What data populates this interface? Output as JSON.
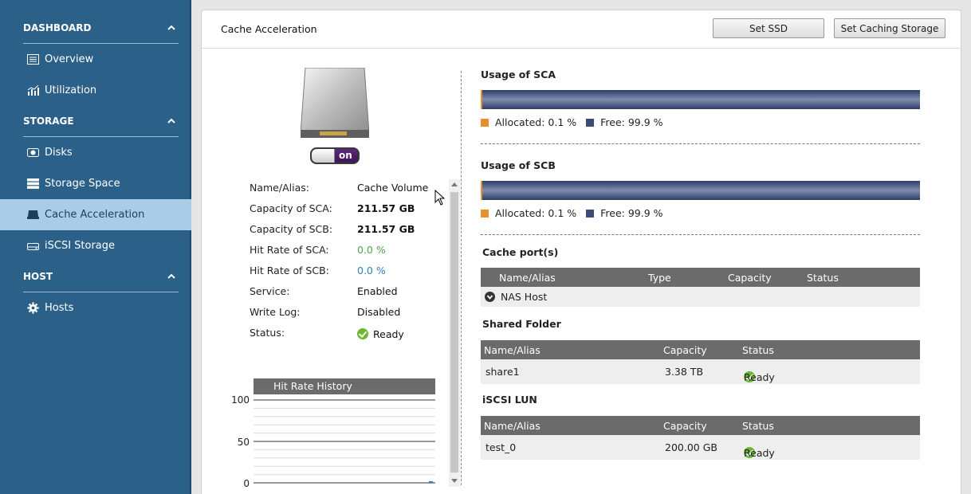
{
  "sidebar": {
    "sections": [
      {
        "label": "DASHBOARD"
      },
      {
        "label": "STORAGE"
      },
      {
        "label": "HOST"
      }
    ],
    "items": [
      {
        "label": "Overview",
        "icon": "overview-icon"
      },
      {
        "label": "Utilization",
        "icon": "utilization-icon"
      },
      {
        "label": "Disks",
        "icon": "disk-icon"
      },
      {
        "label": "Storage Space",
        "icon": "storage-space-icon"
      },
      {
        "label": "Cache Acceleration",
        "icon": "cache-icon"
      },
      {
        "label": "iSCSI Storage",
        "icon": "iscsi-icon"
      },
      {
        "label": "Hosts",
        "icon": "gear-icon"
      }
    ]
  },
  "panel": {
    "title": "Cache Acceleration",
    "set_ssd_label": "Set SSD",
    "set_caching_label": "Set Caching Storage"
  },
  "toggle": {
    "label": "on"
  },
  "info": {
    "name_label": "Name/Alias:",
    "name_value": "Cache Volume",
    "sca_cap_label": "Capacity of SCA:",
    "sca_cap_value": "211.57 GB",
    "scb_cap_label": "Capacity of SCB:",
    "scb_cap_value": "211.57 GB",
    "sca_hit_label": "Hit Rate of SCA:",
    "sca_hit_value": "0.0 %",
    "scb_hit_label": "Hit Rate of SCB:",
    "scb_hit_value": "0.0 %",
    "service_label": "Service:",
    "service_value": "Enabled",
    "writelog_label": "Write Log:",
    "writelog_value": "Disabled",
    "status_label": "Status:",
    "status_value": "Ready"
  },
  "chart_data": {
    "type": "line",
    "title": "Hit Rate History",
    "yticks": [
      "100",
      "50",
      "0"
    ],
    "ylim": [
      0,
      100
    ],
    "series": [
      {
        "values": [
          0
        ]
      }
    ]
  },
  "usage_sca": {
    "title": "Usage of SCA",
    "allocated_label": "Allocated: 0.1 %",
    "free_label": "Free: 99.9 %",
    "allocated_fraction": 0.001
  },
  "usage_scb": {
    "title": "Usage of SCB",
    "allocated_label": "Allocated: 0.1 %",
    "free_label": "Free: 99.9 %",
    "allocated_fraction": 0.001
  },
  "colors": {
    "allocated": "#e8902f",
    "free": "#3b4a78",
    "sidebar": "#2b6088",
    "active": "#a9cde6"
  },
  "cache_ports": {
    "title": "Cache port(s)",
    "columns": [
      "Name/Alias",
      "Type",
      "Capacity",
      "Status"
    ],
    "rows": [
      {
        "name": "NAS Host"
      }
    ]
  },
  "shared_folder": {
    "title": "Shared Folder",
    "columns": [
      "Name/Alias",
      "Capacity",
      "Status"
    ],
    "rows": [
      {
        "name": "share1",
        "capacity": "3.38 TB",
        "status": "Ready"
      }
    ]
  },
  "iscsi_lun": {
    "title": "iSCSI LUN",
    "columns": [
      "Name/Alias",
      "Capacity",
      "Status"
    ],
    "rows": [
      {
        "name": "test_0",
        "capacity": "200.00 GB",
        "status": "Ready"
      }
    ]
  }
}
